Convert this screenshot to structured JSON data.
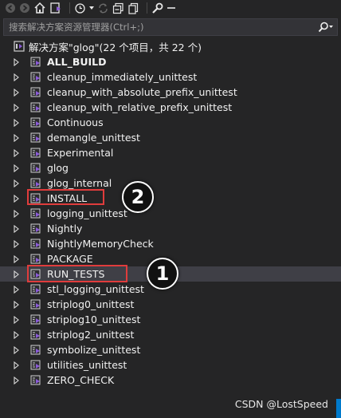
{
  "search": {
    "placeholder": "搜索解决方案资源管理器(Ctrl+;)"
  },
  "solution": {
    "label": "解决方案\"glog\"(22 个项目，共 22 个)"
  },
  "projects": [
    {
      "label": "ALL_BUILD",
      "bold": true
    },
    {
      "label": "cleanup_immediately_unittest"
    },
    {
      "label": "cleanup_with_absolute_prefix_unittest"
    },
    {
      "label": "cleanup_with_relative_prefix_unittest"
    },
    {
      "label": "Continuous"
    },
    {
      "label": "demangle_unittest"
    },
    {
      "label": "Experimental"
    },
    {
      "label": "glog"
    },
    {
      "label": "glog_internal"
    },
    {
      "label": "INSTALL",
      "highlighted": true
    },
    {
      "label": "logging_unittest"
    },
    {
      "label": "Nightly"
    },
    {
      "label": "NightlyMemoryCheck"
    },
    {
      "label": "PACKAGE"
    },
    {
      "label": "RUN_TESTS",
      "highlighted": true,
      "selected": true
    },
    {
      "label": "stl_logging_unittest"
    },
    {
      "label": "striplog0_unittest"
    },
    {
      "label": "striplog10_unittest"
    },
    {
      "label": "striplog2_unittest"
    },
    {
      "label": "symbolize_unittest"
    },
    {
      "label": "utilities_unittest"
    },
    {
      "label": "ZERO_CHECK"
    }
  ],
  "annotations": {
    "badge_install": "2",
    "badge_run_tests": "1"
  },
  "watermark": "CSDN @LostSpeed",
  "colors": {
    "background": "#252526",
    "text": "#f1f1f1",
    "selected_row": "#3f3f46",
    "highlight_box": "#e03c3c",
    "accent": "#007acc",
    "project_icon_accent": "#8a5bd6"
  },
  "toolbar": {
    "icons": [
      "back-icon",
      "forward-icon",
      "home-icon",
      "vs-solution-icon",
      "history-icon",
      "dropdown-icon",
      "sync-icon",
      "collapse-all-icon",
      "copy-icon",
      "properties-icon",
      "minus-icon"
    ]
  }
}
